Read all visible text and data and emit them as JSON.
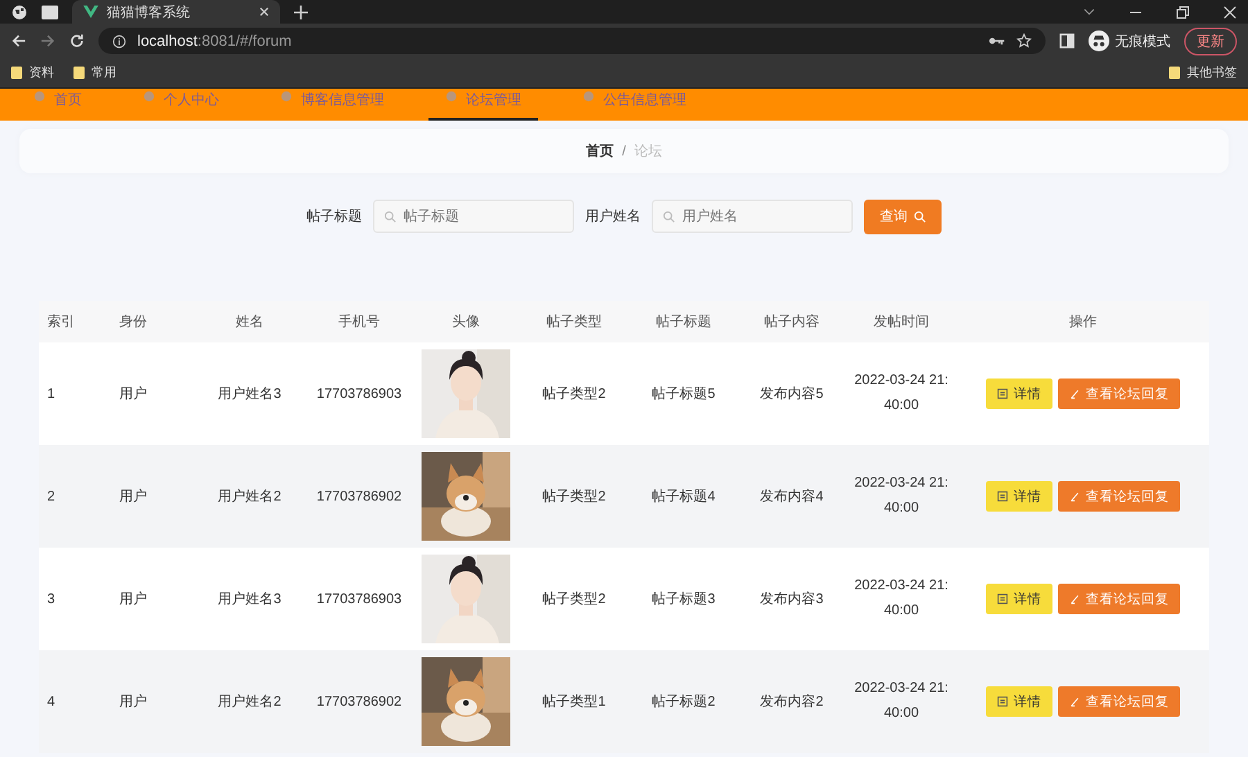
{
  "browser": {
    "tab_title": "猫猫博客系统",
    "url_host": "localhost",
    "url_path": ":8081/#/forum",
    "profile": "无痕模式",
    "update_button": "更新",
    "bookmarks": [
      "资料",
      "常用"
    ],
    "other_bookmarks": "其他书签"
  },
  "nav": [
    {
      "label": "首页",
      "selected": false
    },
    {
      "label": "个人中心",
      "selected": false
    },
    {
      "label": "博客信息管理",
      "selected": false
    },
    {
      "label": "论坛管理",
      "selected": true
    },
    {
      "label": "公告信息管理",
      "selected": false
    }
  ],
  "breadcrumb": [
    {
      "label": "首页",
      "current": false
    },
    {
      "label": "论坛",
      "current": true
    }
  ],
  "breadcrumb_separator": "/",
  "search": {
    "fields": [
      {
        "label": "帖子标题",
        "placeholder": "帖子标题"
      },
      {
        "label": "用户姓名",
        "placeholder": "用户姓名"
      }
    ],
    "button": "查询"
  },
  "table": {
    "columns": [
      "索引",
      "身份",
      "姓名",
      "手机号",
      "头像",
      "帖子类型",
      "帖子标题",
      "帖子内容",
      "发帖时间",
      "操作"
    ],
    "rows": [
      {
        "index": "1",
        "role": "用户",
        "name": "用户姓名3",
        "phone": "17703786903",
        "type": "帖子类型2",
        "title": "帖子标题5",
        "content": "发布内容5",
        "time": "2022-03-24 21:40:00",
        "actions": [
          "详情",
          "查看论坛回复"
        ]
      },
      {
        "index": "2",
        "role": "用户",
        "name": "用户姓名2",
        "phone": "17703786902",
        "type": "帖子类型2",
        "title": "帖子标题4",
        "content": "发布内容4",
        "time": "2022-03-24 21:40:00",
        "actions": [
          "详情",
          "查看论坛回复"
        ]
      },
      {
        "index": "3",
        "role": "用户",
        "name": "用户姓名3",
        "phone": "17703786903",
        "type": "帖子类型2",
        "title": "帖子标题3",
        "content": "发布内容3",
        "time": "2022-03-24 21:40:00",
        "actions": [
          "详情",
          "查看论坛回复"
        ]
      },
      {
        "index": "4",
        "role": "用户",
        "name": "用户姓名2",
        "phone": "17703786902",
        "type": "帖子类型1",
        "title": "帖子标题2",
        "content": "发布内容2",
        "time": "2022-03-24 21:40:00",
        "actions": [
          "详情",
          "查看论坛回复"
        ]
      }
    ]
  }
}
